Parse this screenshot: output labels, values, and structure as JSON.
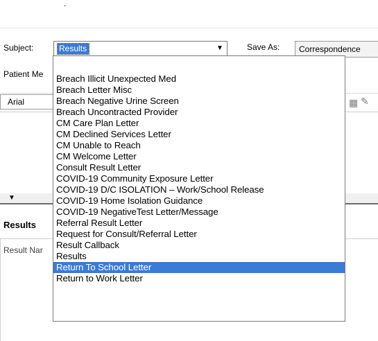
{
  "decor": {
    "dot": "."
  },
  "form": {
    "subject_label": "Subject:",
    "subject_value": "Results",
    "save_as_label": "Save As:",
    "save_as_value": "Correspondence",
    "patient_label": "Patient Me",
    "font_name": "Arial"
  },
  "results": {
    "heading": "Results",
    "column_header": "Result Nar"
  },
  "dropdown": {
    "items": [
      "Breach Illicit Unexpected Med",
      "Breach Letter Misc",
      "Breach Negative Urine Screen",
      "Breach Uncontracted Provider",
      "CM Care Plan Letter",
      "CM Declined Services Letter",
      "CM Unable to Reach",
      "CM Welcome Letter",
      "Consult Result Letter",
      "COVID-19 Community Exposure Letter",
      "COVID-19 D/C ISOLATION – Work/School Release",
      "COVID-19 Home Isolation Guidance",
      "COVID-19 NegativeTest Letter/Message",
      "Referral Result Letter",
      "Request for Consult/Referral Letter",
      "Result Callback",
      "Results",
      "Return To School Letter",
      "Return to Work Letter"
    ],
    "highlighted_index": 17
  },
  "colors": {
    "selection": "#3a7bd5",
    "panel_bg": "#f0f0f0"
  }
}
